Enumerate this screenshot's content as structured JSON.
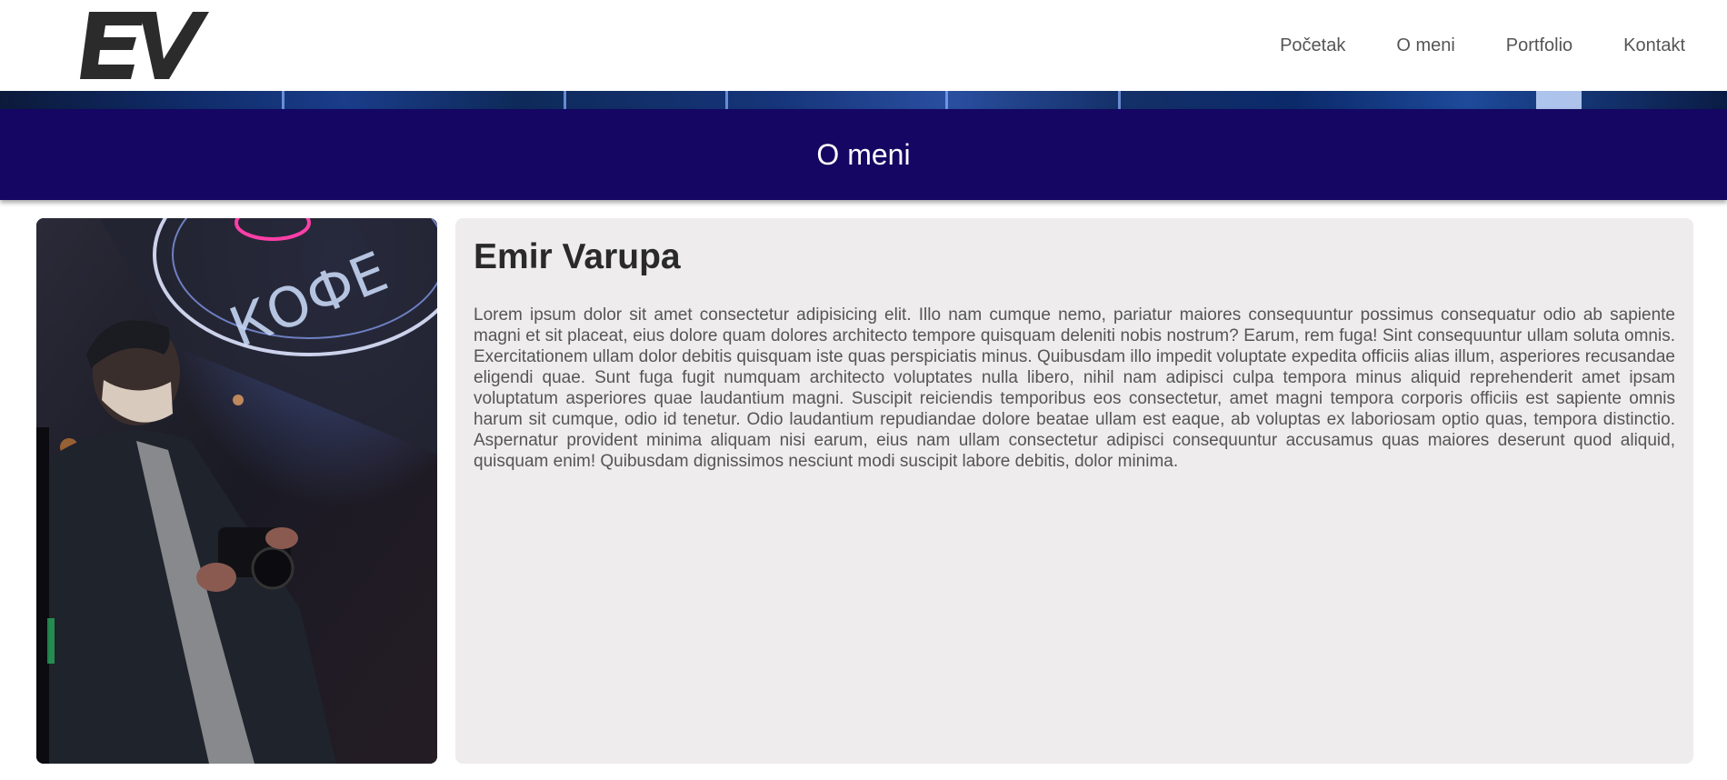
{
  "header": {
    "logo_text": "EV",
    "nav": [
      {
        "label": "Početak"
      },
      {
        "label": "O meni"
      },
      {
        "label": "Portfolio"
      },
      {
        "label": "Kontakt"
      }
    ]
  },
  "page_title": "O meni",
  "photo": {
    "sign_text": "КОФЕ"
  },
  "bio": {
    "name": "Emir Varupa",
    "text": "Lorem ipsum dolor sit amet consectetur adipisicing elit. Illo nam cumque nemo, pariatur maiores consequuntur possimus consequatur odio ab sapiente magni et sit placeat, eius dolore quam dolores architecto tempore quisquam deleniti nobis nostrum? Earum, rem fuga! Sint consequuntur ullam soluta omnis. Exercitationem ullam dolor debitis quisquam iste quas perspiciatis minus. Quibusdam illo impedit voluptate expedita officiis alias illum, asperiores recusandae eligendi quae. Sunt fuga fugit numquam architecto voluptates nulla libero, nihil nam adipisci culpa tempora minus aliquid reprehenderit amet ipsam voluptatum asperiores quae laudantium magni. Suscipit reiciendis temporibus eos consectetur, amet magni tempora corporis officiis est sapiente omnis harum sit cumque, odio id tenetur. Odio laudantium repudiandae dolore beatae ullam est eaque, ab voluptas ex laboriosam optio quas, tempora distinctio. Aspernatur provident minima aliquam nisi earum, eius nam ullam consectetur adipisci consequuntur accusamus quas maiores deserunt quod aliquid, quisquam enim! Quibusdam dignissimos nesciunt modi suscipit labore debitis, dolor minima."
  },
  "colors": {
    "title_band": "#140662",
    "card_background": "#eeecec",
    "nav_text": "#555555",
    "logo": "#2b2b2b"
  }
}
